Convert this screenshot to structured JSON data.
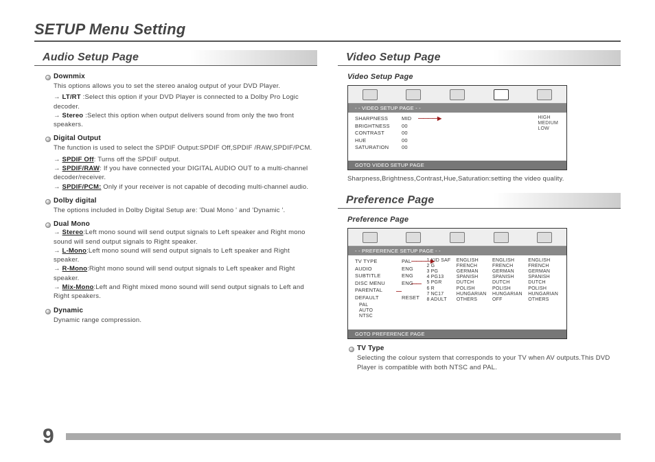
{
  "page_title": "SETUP Menu Setting",
  "page_number": "9",
  "audio": {
    "header": "Audio Setup Page",
    "items": [
      {
        "title": "Downmix",
        "desc": "This options allows you to set the stereo analog output of your DVD Player.",
        "arrows": [
          {
            "label": "LT/RT",
            "style": "b",
            "text": " :Select  this option if your DVD Player  is  connected  to  a Dolby Pro Logic decoder."
          },
          {
            "label": "Stereo",
            "style": "b",
            "text": " :Select this option when output delivers sound from only the two  front speakers."
          }
        ]
      },
      {
        "title": "Digital Output",
        "desc": "The function is used to select  the SPDIF Output:SPDIF Off,SPDIF /RAW,SPDIF/PCM.",
        "arrows": [
          {
            "label": "SPDIF Off",
            "style": "u",
            "text": ": Turns off the SPDIF output."
          },
          {
            "label": "SPDIF/RAW",
            "style": "u",
            "text": ":  If you have connected  your  DIGITAL AUDIO OUT to a multi-channel decoder/receiver."
          },
          {
            "label": "SPDIF/PCM:",
            "style": "u",
            "text": "  Only if your receiver is not capable of decoding  multi-channel audio."
          }
        ]
      },
      {
        "title": "Dolby digital",
        "desc": "The options included in Dolby Digital Setup are: 'Dual Mono ' and  'Dynamic '."
      },
      {
        "title": "Dual Mono",
        "arrows": [
          {
            "label": "Stereo",
            "style": "u",
            "text": ":Left mono sound will send output signals to Left speaker and Right mono sound will send output signals to Right speaker."
          },
          {
            "label": "L-Mono",
            "style": "u",
            "text": ":Left mono sound will send output signals to Left speaker and Right speaker."
          },
          {
            "label": "R-Mono",
            "style": "u",
            "text": ":Right mono sound will send output signals to Left speaker  and Right speaker."
          },
          {
            "label": "Mix-Mono",
            "style": "u",
            "text": ":Left and Right mixed mono sound will send output signals  to Left and Right speakers."
          }
        ]
      },
      {
        "title": "Dynamic",
        "desc": "Dynamic range compression."
      }
    ]
  },
  "video": {
    "header": "Video Setup Page",
    "subhead": "Video Setup Page",
    "osd": {
      "subtitle": "- -  VIDEO SETUP PAGE  - -",
      "rows": [
        {
          "k": "SHARPNESS",
          "v": "MID"
        },
        {
          "k": "BRIGHTNESS",
          "v": "00"
        },
        {
          "k": "CONTRAST",
          "v": "00"
        },
        {
          "k": "HUE",
          "v": "00"
        },
        {
          "k": "SATURATION",
          "v": "00"
        }
      ],
      "side": [
        "HIGH",
        "MEDIUM",
        "LOW"
      ],
      "footer": "GOTO VIDEO SETUP PAGE"
    },
    "caption": "Sharpness,Brightness,Contrast,Hue,Saturation:setting the video quality."
  },
  "pref": {
    "header": "Preference Page",
    "subhead": "Preference Page",
    "osd": {
      "subtitle": "- -  PREFERENCE SETUP PAGE  - -",
      "rows": [
        {
          "k": "TV TYPE",
          "v": "PAL"
        },
        {
          "k": "AUDIO",
          "v": "ENG"
        },
        {
          "k": "SUBTITLE",
          "v": "ENG"
        },
        {
          "k": "DISC MENU",
          "v": "ENG"
        },
        {
          "k": "PARENTAL",
          "v": ""
        },
        {
          "k": "DEFAULT",
          "v": "RESET"
        }
      ],
      "parental_list": [
        "1 KID SAF",
        "2 G",
        "3 PG",
        "4 PG13",
        "5 PGR",
        "6 R",
        "7 NC17",
        "8 ADULT"
      ],
      "lang_lists": [
        [
          "ENGLISH",
          "FRENCH",
          "GERMAN",
          "SPANISH",
          "DUTCH",
          "POLISH",
          "HUNGARIAN",
          "OTHERS"
        ],
        [
          "ENGLISH",
          "FRENCH",
          "GERMAN",
          "SPANISH",
          "DUTCH",
          "POLISH",
          "HUNGARIAN",
          "OFF"
        ],
        [
          "ENGLISH",
          "FRENCH",
          "GERMAN",
          "SPANISH",
          "DUTCH",
          "POLISH",
          "HUNGARIAN",
          "OTHERS"
        ]
      ],
      "tv_list": [
        "PAL",
        "AUTO",
        "NTSC"
      ],
      "footer": "GOTO PREFERENCE PAGE"
    },
    "tvtype": {
      "title": "TV Type",
      "desc": "Selecting the colour system that corresponds to your TV when AV outputs.This DVD Player is compatible with both NTSC and  PAL."
    }
  }
}
